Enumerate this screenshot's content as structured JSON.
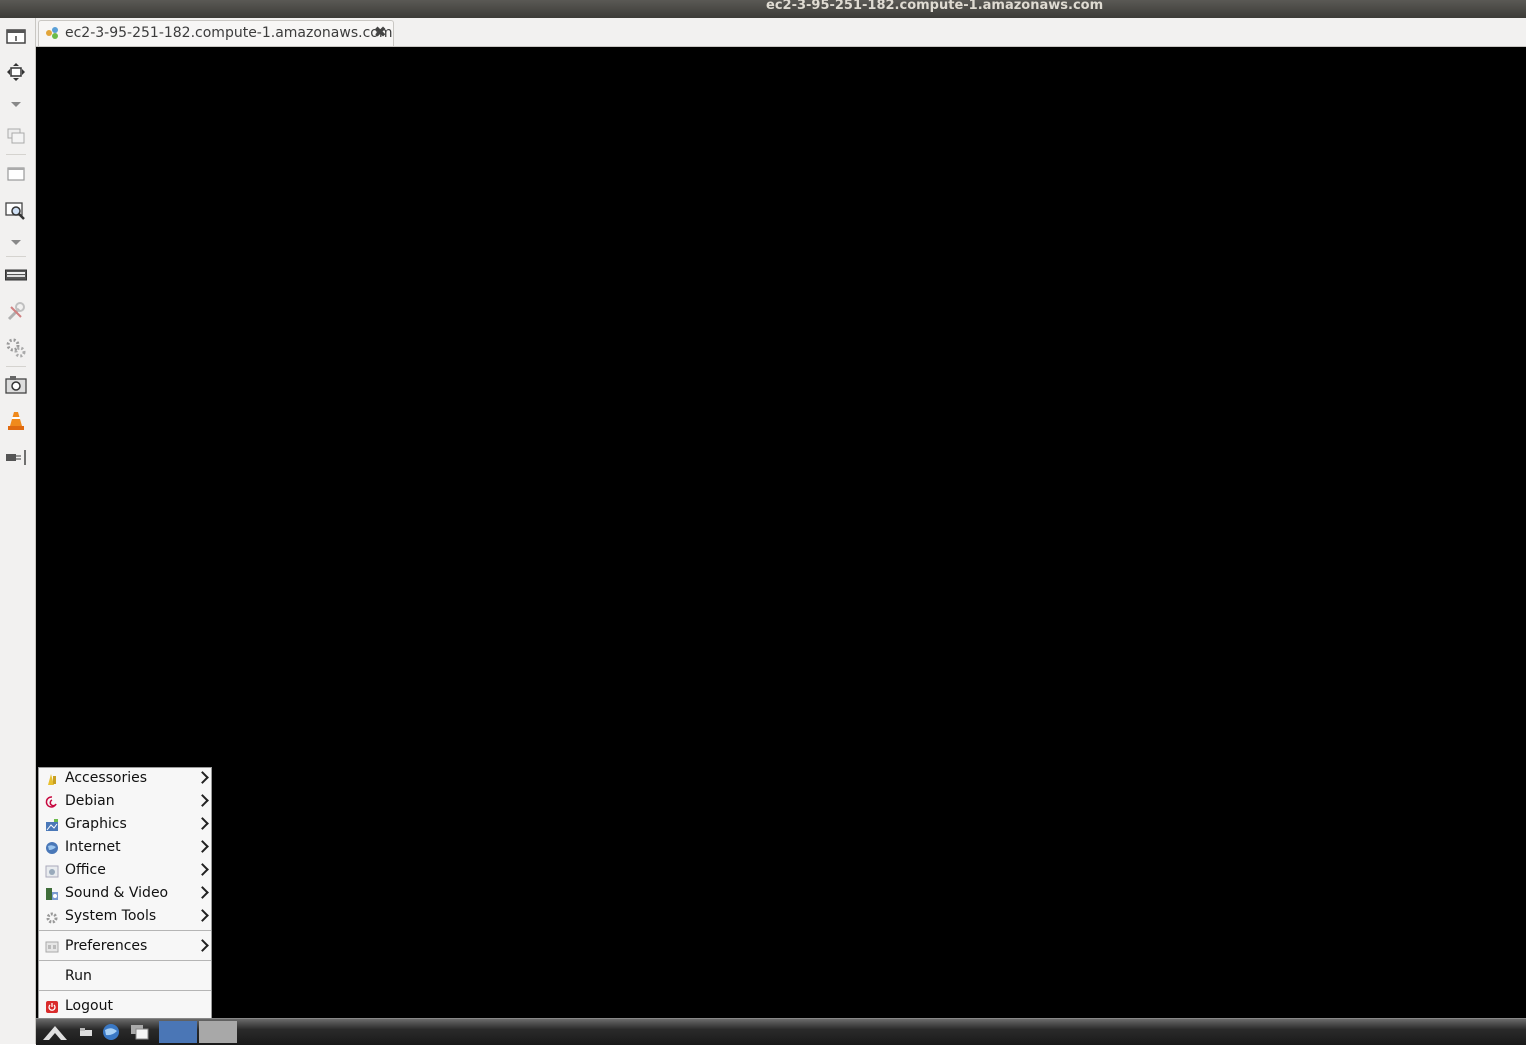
{
  "window": {
    "title": "ec2-3-95-251-182.compute-1.amazonaws.com"
  },
  "tab": {
    "label": "ec2-3-95-251-182.compute-1.amazonaws.com",
    "close_glyph": "✖"
  },
  "toolbar": {
    "icons": [
      "window-icon",
      "fullscreen-icon",
      "dropdown-icon",
      "multi-window-icon",
      "minimize-window-icon",
      "zoom-icon",
      "dropdown-icon",
      "keyboard-icon",
      "tools-icon",
      "preferences-icon",
      "screenshot-icon",
      "vlc-icon",
      "disconnect-icon"
    ]
  },
  "menu": {
    "items": [
      {
        "label": "Accessories",
        "icon": "accessories-icon",
        "submenu": true
      },
      {
        "label": "Debian",
        "icon": "debian-icon",
        "submenu": true
      },
      {
        "label": "Graphics",
        "icon": "graphics-icon",
        "submenu": true
      },
      {
        "label": "Internet",
        "icon": "internet-icon",
        "submenu": true
      },
      {
        "label": "Office",
        "icon": "office-icon",
        "submenu": true
      },
      {
        "label": "Sound & Video",
        "icon": "sound-video-icon",
        "submenu": true
      },
      {
        "label": "System Tools",
        "icon": "system-tools-icon",
        "submenu": true
      },
      {
        "label": "Preferences",
        "icon": "preferences-icon",
        "submenu": true
      },
      {
        "label": "Run",
        "icon": "",
        "submenu": false
      },
      {
        "label": "Logout",
        "icon": "logout-icon",
        "submenu": false
      }
    ]
  },
  "colors": {
    "remote_bg": "#000000",
    "titlebar": "#3c3b37",
    "task_active": "#4a76b6"
  }
}
